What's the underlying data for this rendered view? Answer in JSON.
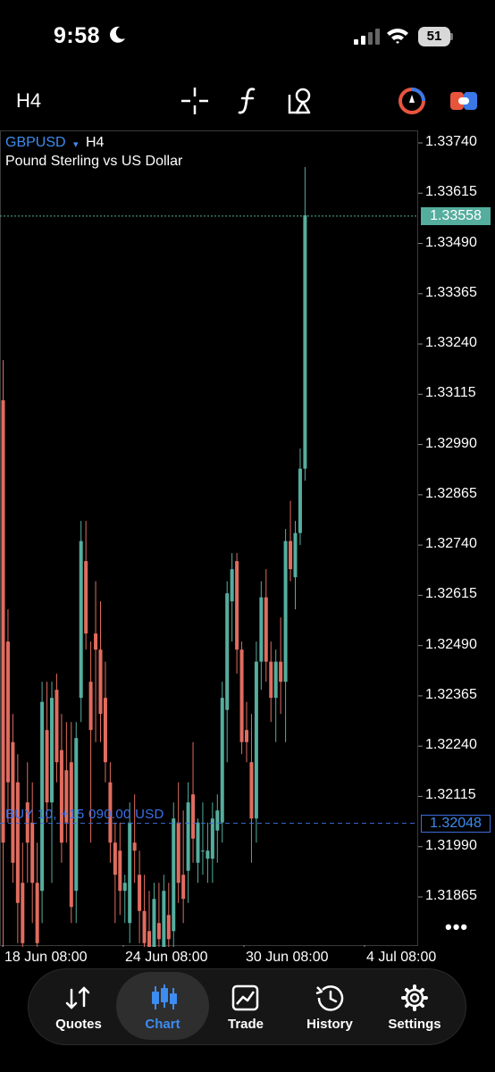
{
  "status": {
    "time": "9:58",
    "battery": "51"
  },
  "toolbar": {
    "timeframe": "H4"
  },
  "symbol": {
    "name": "GBPUSD",
    "caret": "▾",
    "timeframe": "H4",
    "description": "Pound Sterling vs US Dollar"
  },
  "chart_data": {
    "type": "candlestick",
    "symbol": "GBPUSD",
    "timeframe": "H4",
    "y_ticks": [
      "1.33740",
      "1.33615",
      "1.33490",
      "1.33365",
      "1.33240",
      "1.33115",
      "1.32990",
      "1.32865",
      "1.32740",
      "1.32615",
      "1.32490",
      "1.32365",
      "1.32240",
      "1.32115",
      "1.31990",
      "1.31865"
    ],
    "x_ticks": [
      "18 Jun 08:00",
      "24 Jun 08:00",
      "30 Jun 08:00",
      "4 Jul 08:00"
    ],
    "ylim": [
      1.3181,
      1.338
    ],
    "bid_price": "1.33558",
    "position_price": "1.32048",
    "position_label": "BUY 10, +15 090.00 USD",
    "up_color": "#55ad9e",
    "down_color": "#e06c5f",
    "candles": [
      [
        1.331,
        1.332,
        1.317,
        1.32
      ],
      [
        1.325,
        1.3258,
        1.3205,
        1.3215
      ],
      [
        1.3225,
        1.3232,
        1.319,
        1.3195
      ],
      [
        1.3215,
        1.3222,
        1.3175,
        1.3185
      ],
      [
        1.319,
        1.32,
        1.317,
        1.3175
      ],
      [
        1.321,
        1.322,
        1.319,
        1.32
      ],
      [
        1.3205,
        1.3215,
        1.318,
        1.319
      ],
      [
        1.319,
        1.32,
        1.3165,
        1.3175
      ],
      [
        1.3188,
        1.324,
        1.318,
        1.3235
      ],
      [
        1.3228,
        1.324,
        1.3205,
        1.321
      ],
      [
        1.321,
        1.324,
        1.319,
        1.3236
      ],
      [
        1.3238,
        1.3242,
        1.3215,
        1.322
      ],
      [
        1.3223,
        1.3232,
        1.3195,
        1.32
      ],
      [
        1.3218,
        1.323,
        1.32,
        1.3205
      ],
      [
        1.322,
        1.323,
        1.318,
        1.3184
      ],
      [
        1.3188,
        1.323,
        1.318,
        1.3226
      ],
      [
        1.3236,
        1.328,
        1.323,
        1.3275
      ],
      [
        1.327,
        1.328,
        1.3248,
        1.3252
      ],
      [
        1.324,
        1.325,
        1.32,
        1.3228
      ],
      [
        1.3252,
        1.3265,
        1.3225,
        1.3248
      ],
      [
        1.3248,
        1.326,
        1.3225,
        1.3232
      ],
      [
        1.3236,
        1.3245,
        1.3215,
        1.322
      ],
      [
        1.3215,
        1.322,
        1.3195,
        1.32
      ],
      [
        1.32,
        1.3205,
        1.318,
        1.3192
      ],
      [
        1.3198,
        1.3205,
        1.3182,
        1.3188
      ],
      [
        1.3188,
        1.3192,
        1.318,
        1.319
      ],
      [
        1.318,
        1.321,
        1.3175,
        1.3205
      ],
      [
        1.32,
        1.3212,
        1.319,
        1.3198
      ],
      [
        1.3192,
        1.3198,
        1.3175,
        1.3183
      ],
      [
        1.3183,
        1.3192,
        1.317,
        1.3175
      ],
      [
        1.3178,
        1.3188,
        1.3165,
        1.317
      ],
      [
        1.317,
        1.319,
        1.3165,
        1.3186
      ],
      [
        1.318,
        1.319,
        1.3165,
        1.3176
      ],
      [
        1.317,
        1.3192,
        1.316,
        1.3188
      ],
      [
        1.3182,
        1.319,
        1.317,
        1.3176
      ],
      [
        1.3178,
        1.321,
        1.3172,
        1.3206
      ],
      [
        1.3205,
        1.3215,
        1.3185,
        1.319
      ],
      [
        1.3192,
        1.3208,
        1.318,
        1.3186
      ],
      [
        1.3193,
        1.3215,
        1.3185,
        1.321
      ],
      [
        1.3212,
        1.3225,
        1.3195,
        1.3201
      ],
      [
        1.3195,
        1.3206,
        1.319,
        1.3205
      ],
      [
        1.3198,
        1.321,
        1.3192,
        1.3198
      ],
      [
        1.3196,
        1.3205,
        1.319,
        1.3198
      ],
      [
        1.3196,
        1.321,
        1.319,
        1.3206
      ],
      [
        1.3203,
        1.3212,
        1.3195,
        1.3208
      ],
      [
        1.3205,
        1.324,
        1.32,
        1.3236
      ],
      [
        1.3233,
        1.3265,
        1.322,
        1.3262
      ],
      [
        1.326,
        1.3272,
        1.325,
        1.3268
      ],
      [
        1.327,
        1.3272,
        1.3242,
        1.3248
      ],
      [
        1.3248,
        1.325,
        1.3222,
        1.3225
      ],
      [
        1.3228,
        1.3235,
        1.322,
        1.3225
      ],
      [
        1.322,
        1.3232,
        1.3195,
        1.3206
      ],
      [
        1.3206,
        1.325,
        1.32,
        1.3245
      ],
      [
        1.3245,
        1.3265,
        1.3238,
        1.3261
      ],
      [
        1.3261,
        1.3268,
        1.324,
        1.3245
      ],
      [
        1.3245,
        1.325,
        1.323,
        1.3236
      ],
      [
        1.3236,
        1.3248,
        1.3225,
        1.3245
      ],
      [
        1.3245,
        1.3256,
        1.3232,
        1.324
      ],
      [
        1.324,
        1.3278,
        1.3225,
        1.3275
      ],
      [
        1.3275,
        1.3285,
        1.3265,
        1.3268
      ],
      [
        1.3266,
        1.328,
        1.3258,
        1.3277
      ],
      [
        1.3277,
        1.3298,
        1.3274,
        1.3293
      ],
      [
        1.3293,
        1.3368,
        1.329,
        1.3356
      ]
    ]
  },
  "tabs": [
    {
      "id": "quotes",
      "label": "Quotes"
    },
    {
      "id": "chart",
      "label": "Chart"
    },
    {
      "id": "trade",
      "label": "Trade"
    },
    {
      "id": "history",
      "label": "History"
    },
    {
      "id": "settings",
      "label": "Settings"
    }
  ],
  "icons": {
    "crosshair": "crosshair-icon",
    "indicators": "indicators-icon",
    "objects": "objects-icon",
    "account": "account-icon",
    "trade-toggle": "one-click-trading-icon"
  }
}
